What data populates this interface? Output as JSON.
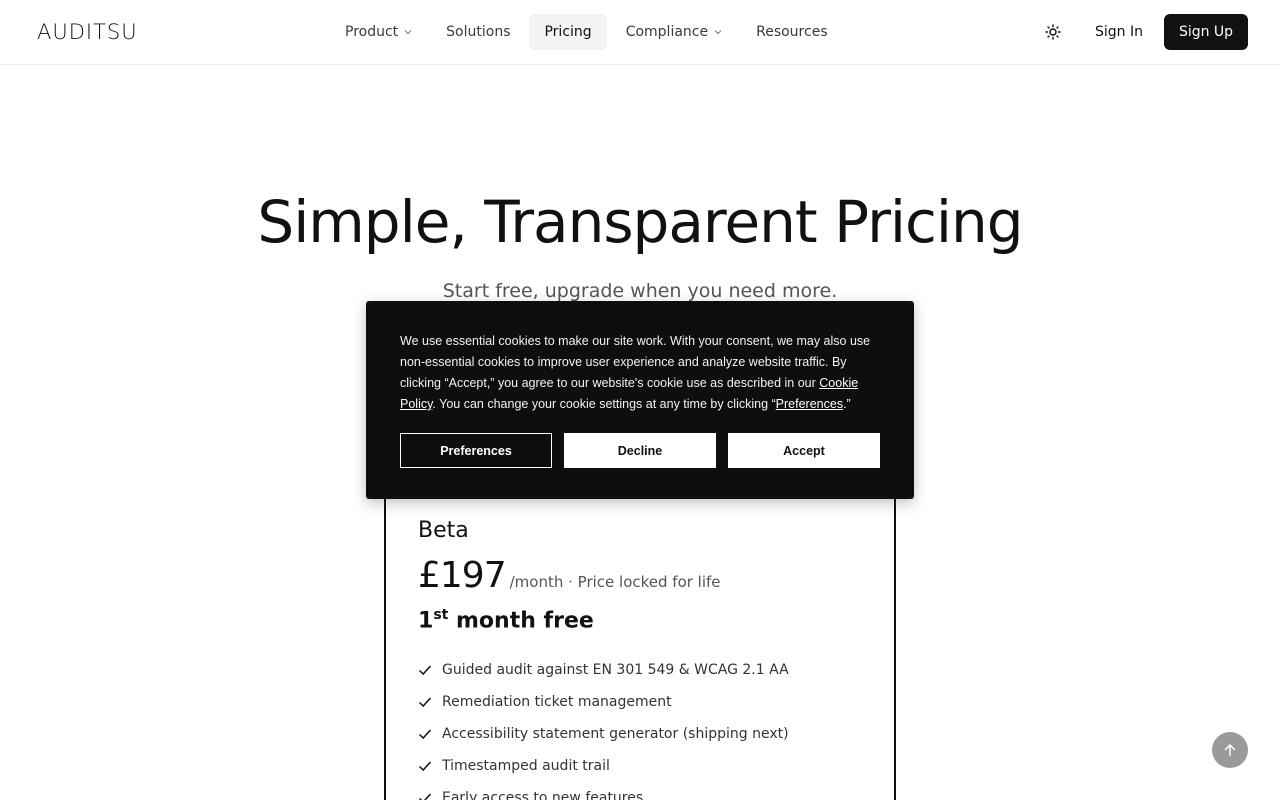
{
  "header": {
    "logo": "AUDITSU",
    "nav": [
      {
        "label": "Product",
        "has_dropdown": true
      },
      {
        "label": "Solutions",
        "has_dropdown": false
      },
      {
        "label": "Pricing",
        "has_dropdown": false,
        "active": true
      },
      {
        "label": "Compliance",
        "has_dropdown": true
      },
      {
        "label": "Resources",
        "has_dropdown": false
      }
    ],
    "theme_icon": "sun-icon",
    "sign_in": "Sign In",
    "sign_up": "Sign Up"
  },
  "hero": {
    "title": "Simple, Transparent Pricing",
    "subtitle": "Start free, upgrade when you need more."
  },
  "plan": {
    "name": "Beta",
    "price": "£197",
    "price_note": "/month · Price locked for life",
    "free_prefix": "1",
    "free_sup": "st",
    "free_suffix": " month free",
    "features": [
      "Guided audit against EN 301 549 & WCAG 2.1 AA",
      "Remediation ticket management",
      "Accessibility statement generator (shipping next)",
      "Timestamped audit trail",
      "Early access to new features"
    ]
  },
  "cookie_banner": {
    "text_1": "We use essential cookies to make our site work. With your consent, we may also use non-essential cookies to improve user experience and analyze website traffic. By clicking “Accept,” you agree to our website's cookie use as described in our ",
    "policy_link": "Cookie Policy",
    "text_2": ". You can change your cookie settings at any time by clicking “",
    "preferences_link": "Preferences",
    "text_3": ".”",
    "buttons": {
      "preferences": "Preferences",
      "decline": "Decline",
      "accept": "Accept"
    }
  },
  "colors": {
    "primary": "#111111",
    "banner_bg": "#0e0e0e",
    "scroll_top_bg": "#9a9a9a"
  }
}
